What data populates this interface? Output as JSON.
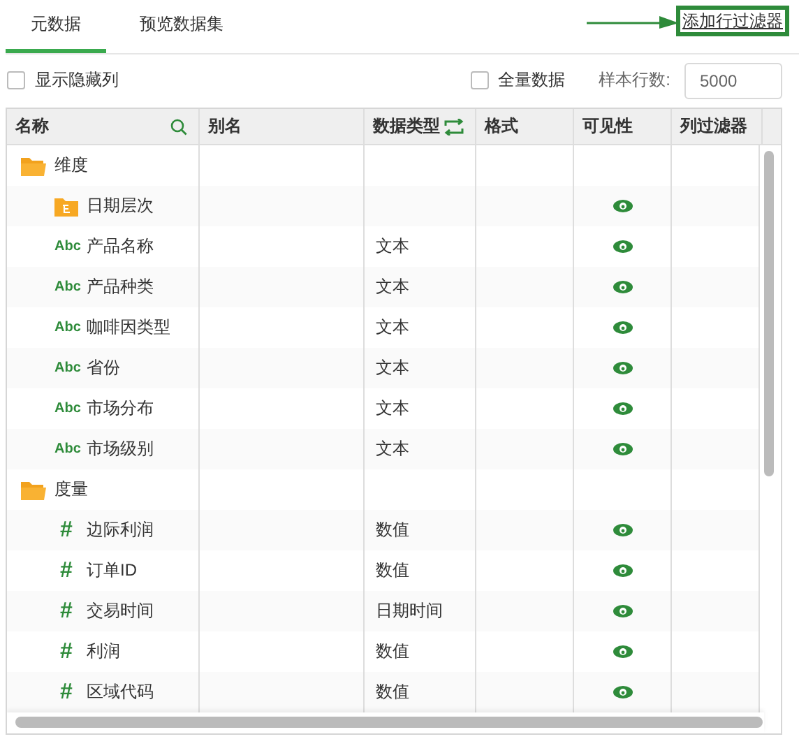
{
  "tabs": [
    {
      "label": "元数据",
      "selected": true
    },
    {
      "label": "预览数据集",
      "selected": false
    }
  ],
  "add_row_filter_link": "添加行过滤器",
  "show_hidden_columns": {
    "label": "显示隐藏列",
    "checked": false
  },
  "full_data": {
    "label": "全量数据",
    "checked": false
  },
  "sample_rows": {
    "label": "样本行数:",
    "value": "5000"
  },
  "table": {
    "columns": [
      {
        "label": "名称",
        "kind": "search"
      },
      {
        "label": "别名",
        "kind": "plain"
      },
      {
        "label": "数据类型",
        "kind": "switch"
      },
      {
        "label": "格式",
        "kind": "plain"
      },
      {
        "label": "可见性",
        "kind": "plain"
      },
      {
        "label": "列过滤器",
        "kind": "plain"
      }
    ],
    "rows": [
      {
        "kind": "folder",
        "name": "维度",
        "children": [
          {
            "kind": "hierarchy",
            "name": "日期层次",
            "visible": true
          },
          {
            "kind": "text",
            "badge": "Abc",
            "name": "产品名称",
            "data_type": "文本",
            "visible": true
          },
          {
            "kind": "text",
            "badge": "Abc",
            "name": "产品种类",
            "data_type": "文本",
            "visible": true
          },
          {
            "kind": "text",
            "badge": "Abc",
            "name": "咖啡因类型",
            "data_type": "文本",
            "visible": true
          },
          {
            "kind": "text",
            "badge": "Abc",
            "name": "省份",
            "data_type": "文本",
            "visible": true
          },
          {
            "kind": "text",
            "badge": "Abc",
            "name": "市场分布",
            "data_type": "文本",
            "visible": true
          },
          {
            "kind": "text",
            "badge": "Abc",
            "name": "市场级别",
            "data_type": "文本",
            "visible": true
          }
        ]
      },
      {
        "kind": "folder",
        "name": "度量",
        "children": [
          {
            "kind": "number",
            "badge": "#",
            "name": "边际利润",
            "data_type": "数值",
            "visible": true
          },
          {
            "kind": "number",
            "badge": "#",
            "name": "订单ID",
            "data_type": "数值",
            "visible": true
          },
          {
            "kind": "number",
            "badge": "#",
            "name": "交易时间",
            "data_type": "日期时间",
            "visible": true
          },
          {
            "kind": "number",
            "badge": "#",
            "name": "利润",
            "data_type": "数值",
            "visible": true
          },
          {
            "kind": "number",
            "badge": "#",
            "name": "区域代码",
            "data_type": "数值",
            "visible": true
          }
        ]
      }
    ]
  }
}
